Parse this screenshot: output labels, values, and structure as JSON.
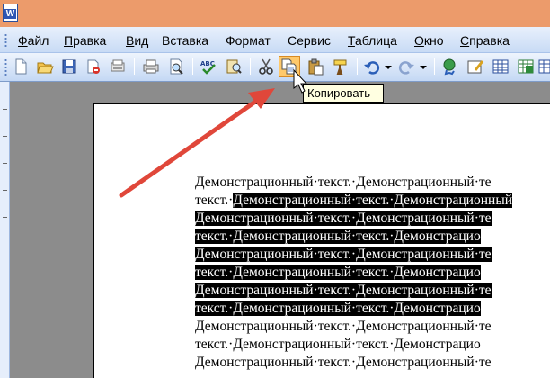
{
  "titlebar": {
    "app_icon_letter": "W"
  },
  "menu": [
    {
      "label": "Файл",
      "underline": "Ф",
      "rest": "айл"
    },
    {
      "label": "Правка",
      "underline": "П",
      "rest": "равка"
    },
    {
      "label": "Вид",
      "underline": "В",
      "rest": "ид"
    },
    {
      "label": "Вставка",
      "underline": "",
      "rest": "Вставка"
    },
    {
      "label": "Формат",
      "underline": "",
      "rest": "Формат"
    },
    {
      "label": "Сервис",
      "underline": "",
      "rest": "Сервис"
    },
    {
      "label": "Таблица",
      "underline": "Т",
      "rest": "аблица"
    },
    {
      "label": "Окно",
      "underline": "О",
      "rest": "кно"
    },
    {
      "label": "Справка",
      "underline": "С",
      "rest": "правка"
    }
  ],
  "tooltip": {
    "text": "Копировать"
  },
  "document": {
    "lines": [
      {
        "before": "Демонстрационный·текст.·Демонстрационный·те",
        "selected": ""
      },
      {
        "before": "текст.·",
        "selected": "Демонстрационный·текст.·Демонстрационный"
      },
      {
        "before": "",
        "selected": "Демонстрационный·текст.·Демонстрационный·те"
      },
      {
        "before": "",
        "selected": "текст.·Демонстрационный·текст.·Демонстрацио"
      },
      {
        "before": "",
        "selected": "Демонстрационный·текст.·Демонстрационный·те"
      },
      {
        "before": "",
        "selected": "текст.·Демонстрационный·текст.·Демонстрацио"
      },
      {
        "before": "",
        "selected": "Демонстрационный·текст.·Демонстрационный·те"
      },
      {
        "before": "",
        "selected": "текст.·Демонстрационный·текст.·Демонстрацио"
      },
      {
        "before": "Демонстрационный·текст.·Демонстрационный·те",
        "selected": ""
      },
      {
        "before": "текст.·Демонстрационный·текст.·Демонстрацио",
        "selected": ""
      },
      {
        "before": "Демонстрационный·текст.·Демонстрационный·те",
        "selected": ""
      }
    ]
  },
  "colors": {
    "annotation_arrow": "#e0473a",
    "selection": "#000000",
    "titlebar": "#ec9b6b"
  },
  "toolbar_icons": [
    "new-document-icon",
    "open-folder-icon",
    "save-icon",
    "permission-icon",
    "print-preview-printer-icon",
    "print-icon",
    "print-preview-icon",
    "spelling-icon",
    "research-icon",
    "cut-icon",
    "copy-icon",
    "paste-icon",
    "format-painter-icon",
    "undo-icon",
    "undo-dropdown-icon",
    "redo-icon",
    "redo-dropdown-icon",
    "hyperlink-icon",
    "tables-borders-icon",
    "insert-table-icon",
    "insert-excel-icon"
  ]
}
